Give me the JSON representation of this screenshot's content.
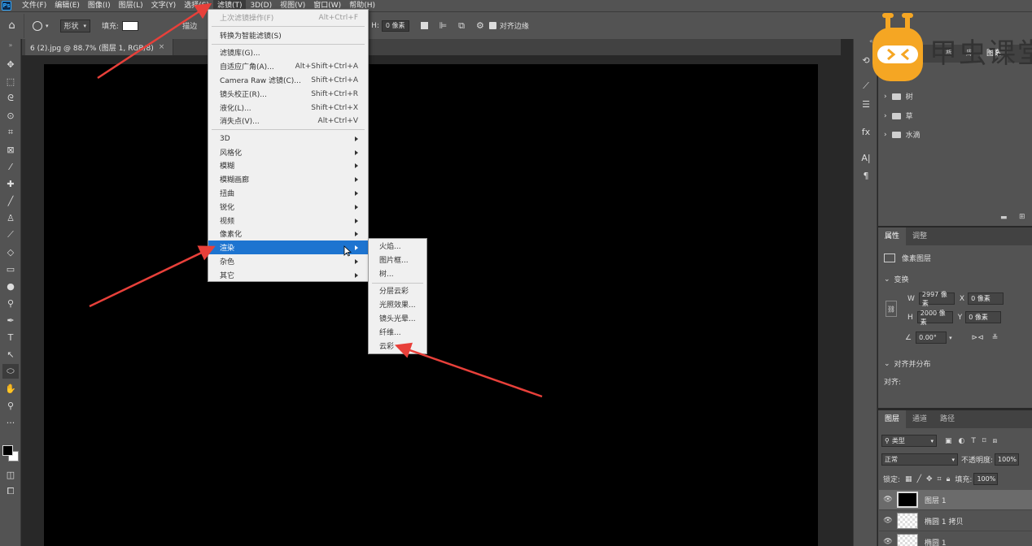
{
  "menubar": {
    "logo": "Ps",
    "items": [
      "文件(F)",
      "编辑(E)",
      "图像(I)",
      "图层(L)",
      "文字(Y)",
      "选择(S)",
      "滤镜(T)",
      "3D(D)",
      "视图(V)",
      "窗口(W)",
      "帮助(H)"
    ]
  },
  "options": {
    "shape_mode": "形状",
    "fill_label": "填充:",
    "stroke_label": "描边",
    "h_value": "0 像素",
    "align_edges": "对齐边缘"
  },
  "document": {
    "tab_title": "6 (2).jpg @ 88.7% (图层 1, RGB/8)",
    "tab_close": "×"
  },
  "filter_menu": {
    "items": [
      {
        "label": "上次滤镜操作(F)",
        "shortcut": "Alt+Ctrl+F",
        "disabled": true
      },
      {
        "label": "转换为智能滤镜(S)",
        "shortcut": ""
      },
      {
        "label": "滤镜库(G)...",
        "shortcut": ""
      },
      {
        "label": "自适应广角(A)...",
        "shortcut": "Alt+Shift+Ctrl+A"
      },
      {
        "label": "Camera Raw 滤镜(C)...",
        "shortcut": "Shift+Ctrl+A"
      },
      {
        "label": "镜头校正(R)...",
        "shortcut": "Shift+Ctrl+R"
      },
      {
        "label": "液化(L)...",
        "shortcut": "Shift+Ctrl+X"
      },
      {
        "label": "消失点(V)...",
        "shortcut": "Alt+Ctrl+V"
      },
      {
        "label": "3D",
        "submenu": true
      },
      {
        "label": "风格化",
        "submenu": true
      },
      {
        "label": "模糊",
        "submenu": true
      },
      {
        "label": "模糊画廊",
        "submenu": true
      },
      {
        "label": "扭曲",
        "submenu": true
      },
      {
        "label": "锐化",
        "submenu": true
      },
      {
        "label": "视频",
        "submenu": true
      },
      {
        "label": "像素化",
        "submenu": true
      },
      {
        "label": "渲染",
        "submenu": true,
        "highlighted": true
      },
      {
        "label": "杂色",
        "submenu": true
      },
      {
        "label": "其它",
        "submenu": true
      }
    ]
  },
  "render_submenu": {
    "items": [
      "火焰...",
      "图片框...",
      "树...",
      "分层云彩",
      "光照效果...",
      "镜头光晕...",
      "纤维...",
      "云彩"
    ]
  },
  "libraries": {
    "tabs": [
      "板",
      "库",
      "图案"
    ],
    "folders": [
      "树",
      "草",
      "水滴"
    ]
  },
  "properties": {
    "tabs": [
      "属性",
      "调整"
    ],
    "layer_type": "像素图层",
    "transform_title": "变换",
    "w_label": "W",
    "w_value": "2997 像素",
    "x_label": "X",
    "x_value": "0 像素",
    "h_label": "H",
    "h_value": "2000 像素",
    "y_label": "Y",
    "y_value": "0 像素",
    "angle_value": "0.00°",
    "align_title": "对齐并分布",
    "align_label": "对齐:"
  },
  "layers_panel": {
    "tabs": [
      "图层",
      "通道",
      "路径"
    ],
    "filter_kind": "类型",
    "blend_mode": "正常",
    "opacity_label": "不透明度:",
    "opacity_value": "100%",
    "lock_label": "锁定:",
    "fill_label": "填充:",
    "fill_value": "100%",
    "layers": [
      {
        "name": "图层 1",
        "selected": true
      },
      {
        "name": "椭圆 1 拷贝",
        "selected": false
      },
      {
        "name": "椭圆 1",
        "selected": false
      }
    ]
  },
  "watermark": {
    "text": "甲虫课堂"
  },
  "colors": {
    "menu_highlight": "#1d74d0",
    "annotation_arrow": "#e8403a",
    "canvas": "#000000"
  }
}
